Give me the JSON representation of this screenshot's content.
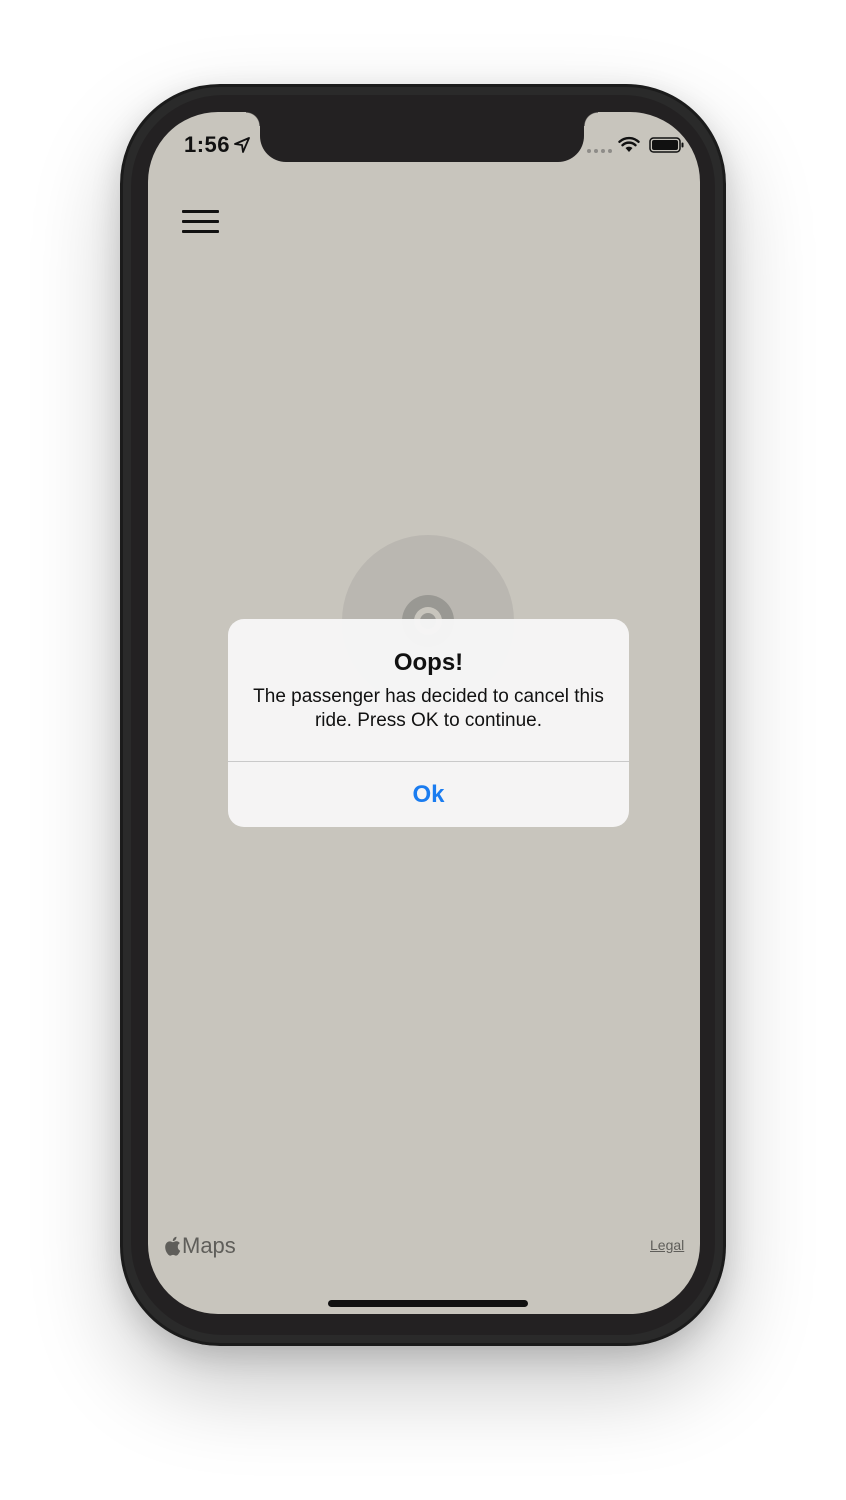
{
  "status_bar": {
    "time": "1:56",
    "icons": [
      "location-arrow-icon",
      "signal-dots-icon",
      "wifi-icon",
      "battery-icon"
    ]
  },
  "header": {
    "menu_icon": "hamburger-menu-icon"
  },
  "alert": {
    "title": "Oops!",
    "message": "The passenger has decided to cancel this ride. Press OK to continue.",
    "button_label": "Ok"
  },
  "map": {
    "attribution": "Maps",
    "legal_label": "Legal"
  },
  "colors": {
    "map_background": "#c8c5bd",
    "accent": "#1a7cf0",
    "phone_frame": "#2a2a2a"
  }
}
